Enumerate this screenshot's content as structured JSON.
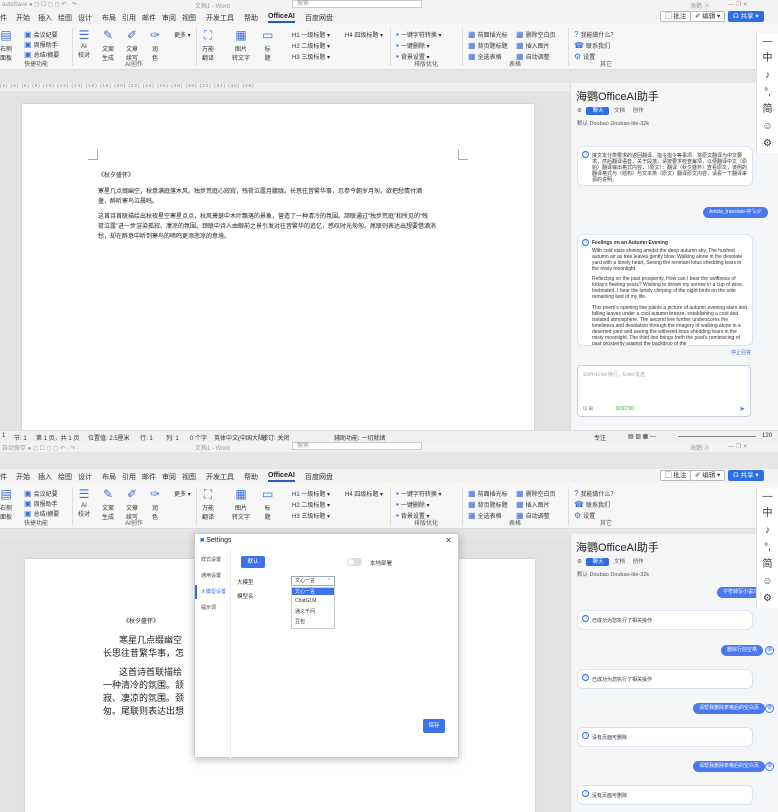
{
  "colors": {
    "accent": "#2b6ee6",
    "ribbon_bg": "#f7f7f7",
    "doc_bg": "#e3e3e3",
    "panel_bg": "#f5f6f8",
    "bubble": "#4a78f0"
  },
  "w1": {
    "title": {
      "left": "autoSave ●  ◻ ☐ ◻ ◻ ↶ · ↷ ·",
      "doc": "文档1 - Word",
      "search": "搜索",
      "user": "海鹦 ⓐ",
      "winctl": "—  ❐  ✕"
    },
    "menu": [
      "件",
      "开始",
      "插入",
      "绘图",
      "设计",
      "布局",
      "引用",
      "邮件",
      "审阅",
      "视图",
      "开发工具",
      "帮助",
      "OfficeAI",
      "百度网盘"
    ],
    "menu_active": "OfficeAI",
    "right_btns": {
      "comment": "▢ 批注",
      "edit": "✐ 编辑 ▾",
      "share": "☊ 共享 ▾"
    }
  },
  "ribbon": {
    "g1_label": "快捷功能",
    "g1_left": [
      "右侧",
      "面板"
    ],
    "g1_items": [
      "会议纪要",
      "周报助手",
      "总结/摘要"
    ],
    "g2_label": "AI创作",
    "g2_btns": [
      "AI\n校对",
      "文案\n生成",
      "文章\n续写",
      "润\n色"
    ],
    "g2_more": "更多 ▾",
    "g3_btns": [
      "万能\n翻译",
      "图片\n转文字",
      "标\n题"
    ],
    "g4_items": [
      "H1 一级标题 ▾",
      "H2 二级标题 ▾",
      "H3 三级标题 ▾",
      "H4 四级标题 ▾"
    ],
    "g5_label": "排版优化",
    "g5_items": [
      "一键字符转换 ▾",
      "一键删除 ▾",
      "背景设置 ▾"
    ],
    "g6_label": "表格",
    "g6_items": [
      "前面插光标",
      "删除空白页",
      "背页题标题",
      "插入图片",
      "全选表格",
      "自动调整"
    ],
    "g7_label": "其它",
    "g7_items": [
      "我能做什么？",
      "联系我们",
      "设置"
    ]
  },
  "ruler": "(2)  (4)  (6)  (8)  (10)  (12)  (14)  (16)  (18)  (20)  (22)  (24)  (26)  (28)  (30)  (32)  (34)  (36)  (38)",
  "doc1": {
    "title": "《秋夕盛怀》",
    "lines": [
      "寒星几点缀幽空，秋意满庭落木风。独步荒庭心寂寂，残荷泣露月朦胧。长思往昔繁华事，忍参今朝岁月匆。欲把愁情付酒",
      "盏，醉听寒鸟泣晨鸣。",
      "这首诗首联描绘出秋夜星空寒星点点，秋风萧瑟中木叶飘落的景象，营造了一种清冷的氛围。颔联通过“独步荒庭”和所见的“残",
      "荷泣露”进一步渲染孤寂、凄凉的氛围。颈联中诗人由眼前之景引发对往昔繁华的追忆，感叹时光匆匆。尾联则表达出想要借酒消",
      "愁，却在醉意中听到寒鸟的啼鸣更添悲凉的意境。"
    ]
  },
  "status1": [
    "1",
    "节: 1",
    "第 1 页，共 1 页",
    "位置值: 2.5厘米",
    "行: 1",
    "列: 1",
    "0 个字",
    "英体中文(中国大陆)",
    "修订: 关闭",
    "辅助功能: 一切就绪",
    "专注",
    "120"
  ],
  "panel": {
    "title": "海鹦OfficeAI助手",
    "close": "✕",
    "tabs": {
      "chat": "聊天",
      "doc": "文档",
      "draw": "创作"
    },
    "model_row": "默认  Doubao   Doubao-lite-32k",
    "msg1": "接文本分类要求的返回翻译。指令指令等事项：将原文翻译为中文要求，然后翻译语音，关于段落，请按要求检查每项，以便翻译中文（原始）翻译输出格式内容，（原文）：翻译（秋夕盛怀）查看原文，该例的翻译格式与（结构）与文本类（原文）翻译原文内容，请看一下翻译来源的说明。",
    "bubble1": "Article_translate-中译英",
    "msg2_title": "Feelings on an Autumn Evening",
    "msg2": [
      "With cold stars shining amidst the deep autumn sky, The hushed autumn air as tree leaves gently blow. Walking alone in the desolate yard with a lonely heart, Seeing the remnant lotus shedding tears in the misty moonlight.",
      "Reflecting on the past prosperity, How can I bear the swiftness of today's fleeting years? Wishing to drown my sorrow in a cup of wine, Inebriated, I hear the lonely chirping of the night birds on the sole remaining bed of my life.",
      "This poem's opening line paints a picture of autumn evening stars and falling leaves under a cool autumn breeze, establishing a cool and isolated atmosphere. The second line further underscores the loneliness and desolation through the imagery of walking alone in a deserted yard and seeing the withered lotus shedding tears in the misty moonlight. The third line brings forth the poet's reminiscing of past prosperity against the backdrop of the"
    ],
    "stop": "停止回答",
    "input_placeholder": "Shift+Enter换行，Enter发送",
    "count": "0/30700"
  },
  "siderail": [
    "—",
    "中",
    "♪",
    "°,",
    "简",
    "☺",
    "⚙"
  ],
  "w2": {
    "title": {
      "left": "自动保存 ● ◻ ☐ ◻ ◻ ↶ · ↷ ·",
      "doc": "文档1 - Word",
      "search": "搜索",
      "user": "海鹦 ⓐ",
      "winctl": "—  ❐  ✕"
    }
  },
  "doc2": {
    "title": "《秋夕盛怀》",
    "lines": [
      "寒星几点缀幽空",
      "长思往昔繁华事，怎",
      "这首诗首联描绘",
      "一种清冷的氛围。颔",
      "寂、凄凉的氛围。颈",
      "匆。尾联则表达出想"
    ]
  },
  "dialog": {
    "title": "Settings",
    "nav": [
      "样式设置",
      "通用设置",
      "大模型设置",
      "提示词"
    ],
    "nav_active": "大模型设置",
    "default_btn": "默认",
    "toggle_label": "本地部署",
    "model_label": "大模型",
    "name_label": "模型名",
    "select_value": "文心一言",
    "options": [
      "文心一言",
      "ChatGLM",
      "通义千问",
      "豆包"
    ],
    "option_active": "文心一言",
    "save": "保存"
  },
  "panel2": {
    "bubble0": "字符转写小说2",
    "m1": "已成功为您执行了相关操作",
    "b1": "删除行前空格",
    "m2": "已成功为您执行了相关操作",
    "b2": "请帮我删除表格后的空白页",
    "m3": "没有页面可删除",
    "b3": "请帮我删除表格后的空白页",
    "m4": "没有页面可删除"
  }
}
